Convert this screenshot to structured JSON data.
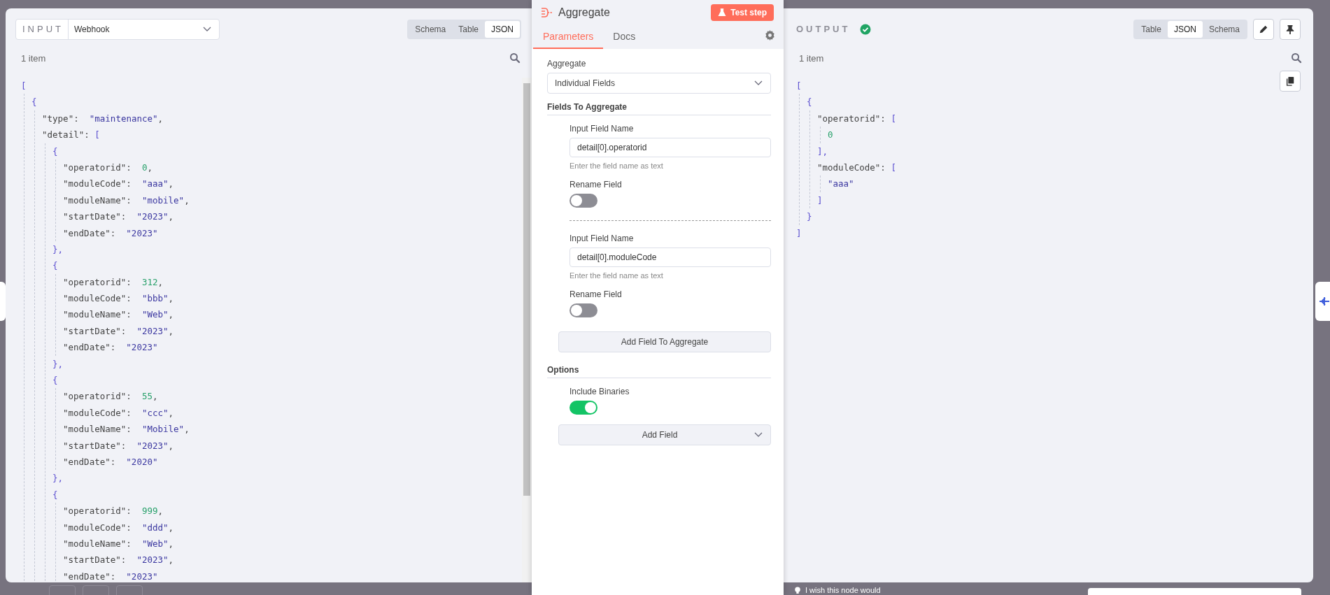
{
  "input_panel": {
    "label": "INPUT",
    "source": "Webhook",
    "view_tabs": [
      {
        "label": "Schema",
        "selected": false
      },
      {
        "label": "Table",
        "selected": false
      },
      {
        "label": "JSON",
        "selected": true
      }
    ],
    "item_count": "1 item",
    "json": [
      {
        "kind": "array",
        "open": "[",
        "children": [
          {
            "kind": "object",
            "open": "{",
            "children": [
              {
                "kind": "string",
                "key": "\"type\":",
                "value": "\"maintenance\"",
                "comma": ","
              },
              {
                "kind": "array",
                "key": "\"detail\":",
                "open": "[",
                "children": [
                  {
                    "kind": "object",
                    "open": "{",
                    "close": "},",
                    "children": [
                      {
                        "kind": "number",
                        "key": "\"operatorid\":",
                        "value": "0",
                        "comma": ","
                      },
                      {
                        "kind": "string",
                        "key": "\"moduleCode\":",
                        "value": "\"aaa\"",
                        "comma": ","
                      },
                      {
                        "kind": "string",
                        "key": "\"moduleName\":",
                        "value": "\"mobile\"",
                        "comma": ","
                      },
                      {
                        "kind": "string",
                        "key": "\"startDate\":",
                        "value": "\"2023\"",
                        "comma": ","
                      },
                      {
                        "kind": "string",
                        "key": "\"endDate\":",
                        "value": "\"2023\""
                      }
                    ]
                  },
                  {
                    "kind": "object",
                    "open": "{",
                    "close": "},",
                    "children": [
                      {
                        "kind": "number",
                        "key": "\"operatorid\":",
                        "value": "312",
                        "comma": ","
                      },
                      {
                        "kind": "string",
                        "key": "\"moduleCode\":",
                        "value": "\"bbb\"",
                        "comma": ","
                      },
                      {
                        "kind": "string",
                        "key": "\"moduleName\":",
                        "value": "\"Web\"",
                        "comma": ","
                      },
                      {
                        "kind": "string",
                        "key": "\"startDate\":",
                        "value": "\"2023\"",
                        "comma": ","
                      },
                      {
                        "kind": "string",
                        "key": "\"endDate\":",
                        "value": "\"2023\""
                      }
                    ]
                  },
                  {
                    "kind": "object",
                    "open": "{",
                    "close": "},",
                    "children": [
                      {
                        "kind": "number",
                        "key": "\"operatorid\":",
                        "value": "55",
                        "comma": ","
                      },
                      {
                        "kind": "string",
                        "key": "\"moduleCode\":",
                        "value": "\"ccc\"",
                        "comma": ","
                      },
                      {
                        "kind": "string",
                        "key": "\"moduleName\":",
                        "value": "\"Mobile\"",
                        "comma": ","
                      },
                      {
                        "kind": "string",
                        "key": "\"startDate\":",
                        "value": "\"2023\"",
                        "comma": ","
                      },
                      {
                        "kind": "string",
                        "key": "\"endDate\":",
                        "value": "\"2020\""
                      }
                    ]
                  },
                  {
                    "kind": "object",
                    "open": "{",
                    "children": [
                      {
                        "kind": "number",
                        "key": "\"operatorid\":",
                        "value": "999",
                        "comma": ","
                      },
                      {
                        "kind": "string",
                        "key": "\"moduleCode\":",
                        "value": "\"ddd\"",
                        "comma": ","
                      },
                      {
                        "kind": "string",
                        "key": "\"moduleName\":",
                        "value": "\"Web\"",
                        "comma": ","
                      },
                      {
                        "kind": "string",
                        "key": "\"startDate\":",
                        "value": "\"2023\"",
                        "comma": ","
                      },
                      {
                        "kind": "string",
                        "key": "\"endDate\":",
                        "value": "\"2023\""
                      }
                    ]
                  }
                ]
              }
            ]
          }
        ]
      }
    ]
  },
  "node_panel": {
    "title": "Aggregate",
    "test_button": "Test step",
    "tabs": [
      {
        "label": "Parameters",
        "selected": true
      },
      {
        "label": "Docs",
        "selected": false
      }
    ],
    "fields": [
      {
        "kind": "select",
        "label": "Aggregate",
        "value": "Individual Fields"
      },
      {
        "kind": "section",
        "title": "Fields To Aggregate",
        "children": [
          {
            "kind": "input",
            "label": "Input Field Name",
            "value": "detail[0].operatorid",
            "hint": "Enter the field name as text"
          },
          {
            "kind": "toggle",
            "label": "Rename Field",
            "on": false
          },
          {
            "kind": "divider"
          },
          {
            "kind": "input",
            "label": "Input Field Name",
            "value": "detail[0].moduleCode",
            "hint": "Enter the field name as text"
          },
          {
            "kind": "toggle",
            "label": "Rename Field",
            "on": false
          },
          {
            "kind": "button",
            "label": "Add Field To Aggregate"
          }
        ]
      },
      {
        "kind": "section",
        "title": "Options",
        "children": [
          {
            "kind": "toggle",
            "label": "Include Binaries",
            "on": true
          },
          {
            "kind": "dropdown_button",
            "label": "Add Field"
          }
        ]
      }
    ]
  },
  "output_panel": {
    "label": "OUTPUT",
    "view_tabs": [
      {
        "label": "Table",
        "selected": false
      },
      {
        "label": "JSON",
        "selected": true
      },
      {
        "label": "Schema",
        "selected": false
      }
    ],
    "item_count": "1 item",
    "json": [
      {
        "kind": "array",
        "open": "[",
        "close": "]",
        "children": [
          {
            "kind": "object",
            "open": "{",
            "close": "}",
            "children": [
              {
                "kind": "array",
                "key": "\"operatorid\":",
                "open": "[",
                "close": "],",
                "children": [
                  {
                    "kind": "number",
                    "value": "0"
                  }
                ]
              },
              {
                "kind": "array",
                "key": "\"moduleCode\":",
                "open": "[",
                "close": "]",
                "children": [
                  {
                    "kind": "string",
                    "value": "\"aaa\""
                  }
                ]
              }
            ]
          }
        ]
      }
    ]
  },
  "feedback": "I wish this node would"
}
